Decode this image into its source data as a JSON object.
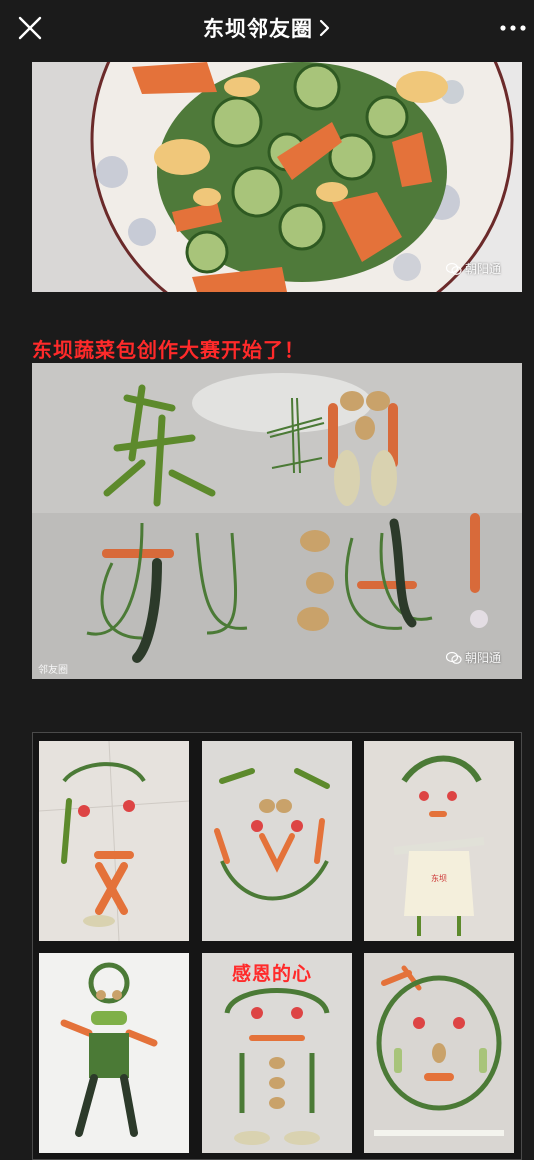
{
  "navbar": {
    "title": "东坝邻友圈",
    "close_icon": "close-icon",
    "chevron_icon": "chevron-right-icon",
    "more_icon": "more-icon"
  },
  "article": {
    "photo1_watermark": "朝阳通",
    "headline": "东坝蔬菜包创作大赛开始了！",
    "photo2_watermark": "朝阳通",
    "photo2_watermark_left": "邻友圈",
    "grid_caption": "感恩的心"
  },
  "colors": {
    "background": "#1b1b1b",
    "headline": "#ff2a2a",
    "navbar_text": "#ffffff"
  }
}
